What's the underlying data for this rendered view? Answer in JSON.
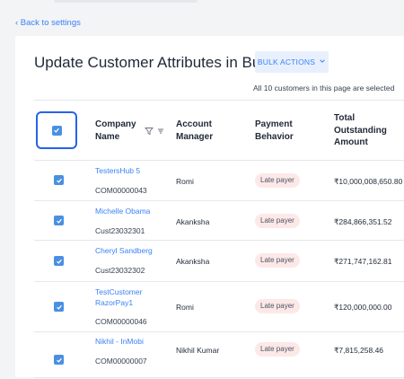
{
  "nav": {
    "back_link": "‹ Back to settings"
  },
  "header": {
    "title": "Update Customer Attributes in Bulk",
    "bulk_actions_label": "BULK ACTIONS",
    "selection_note": "All 10 customers in this page are selected"
  },
  "table": {
    "columns": {
      "company_line1": "Company",
      "company_line2": "Name",
      "manager_line1": "Account",
      "manager_line2": "Manager",
      "payment_line1": "Payment",
      "payment_line2": "Behavior",
      "amount_line1": "Total",
      "amount_line2": "Outstanding",
      "amount_line3": "Amount"
    },
    "rows": [
      {
        "name": "TestersHub 5",
        "code": "COM00000043",
        "manager": "Romi",
        "behavior": "Late payer",
        "amount": "₹10,000,008,650.80",
        "checked": true
      },
      {
        "name": "Michelle Obama",
        "code": "Cust23032301",
        "manager": "Akanksha",
        "behavior": "Late payer",
        "amount": "₹284,866,351.52",
        "checked": true
      },
      {
        "name": "Cheryl Sandberg",
        "code": "Cust23032302",
        "manager": "Akanksha",
        "behavior": "Late payer",
        "amount": "₹271,747,162.81",
        "checked": true
      },
      {
        "name": "TestCustomer RazorPay1",
        "code": "COM00000046",
        "manager": "Romi",
        "behavior": "Late payer",
        "amount": "₹120,000,000.00",
        "checked": true
      },
      {
        "name": "Nikhil - InMobi",
        "code": "COM00000007",
        "manager": "Nikhil Kumar",
        "behavior": "Late payer",
        "amount": "₹7,815,258.46",
        "checked": true
      }
    ]
  },
  "icons": {
    "header_checkbox": "checkbox-checked-icon",
    "filter": "filter-icon",
    "sort": "sort-icon",
    "dropdown": "chevron-down-icon"
  },
  "colors": {
    "accent": "#3b82f6",
    "checkbox": "#4a90e2",
    "focus_ring": "#2563eb",
    "badge_bg": "#fde8e8"
  }
}
